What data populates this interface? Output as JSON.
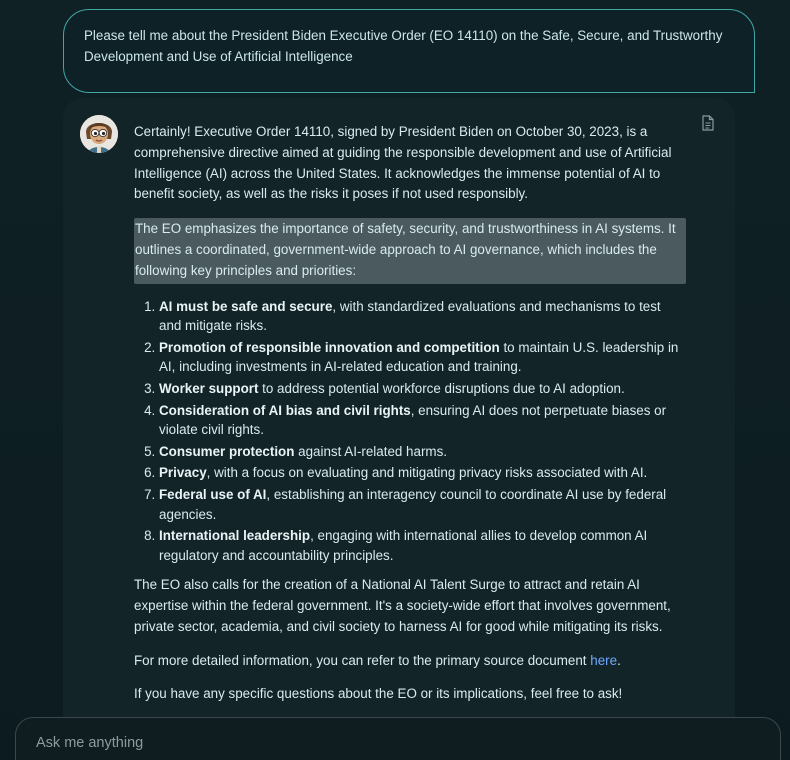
{
  "user_message": "Please tell me about the President Biden Executive Order (EO 14110) on the Safe, Secure, and Trustworthy Development and Use of Artificial Intelligence",
  "assistant": {
    "intro": "Certainly! Executive Order 14110, signed by President Biden on October 30, 2023, is a comprehensive directive aimed at guiding the responsible development and use of Artificial Intelligence (AI) across the United States. It acknowledges the immense potential of AI to benefit society, as well as the risks it poses if not used responsibly.",
    "highlighted": "The EO emphasizes the importance of safety, security, and trustworthiness in AI systems. It outlines a coordinated, government-wide approach to AI governance, which includes the following key principles and priorities:",
    "principles": [
      {
        "bold": "AI must be safe and secure",
        "rest": ", with standardized evaluations and mechanisms to test and mitigate risks."
      },
      {
        "bold": "Promotion of responsible innovation and competition",
        "rest": " to maintain U.S. leadership in AI, including investments in AI-related education and training."
      },
      {
        "bold": "Worker support",
        "rest": " to address potential workforce disruptions due to AI adoption."
      },
      {
        "bold": "Consideration of AI bias and civil rights",
        "rest": ", ensuring AI does not perpetuate biases or violate civil rights."
      },
      {
        "bold": "Consumer protection",
        "rest": " against AI-related harms."
      },
      {
        "bold": "Privacy",
        "rest": ", with a focus on evaluating and mitigating privacy risks associated with AI."
      },
      {
        "bold": "Federal use of AI",
        "rest": ", establishing an interagency council to coordinate AI use by federal agencies."
      },
      {
        "bold": "International leadership",
        "rest": ", engaging with international allies to develop common AI regulatory and accountability principles."
      }
    ],
    "talent_surge": "The EO also calls for the creation of a National AI Talent Surge to attract and retain AI expertise within the federal government. It's a society-wide effort that involves government, private sector, academia, and civil society to harness AI for good while mitigating its risks.",
    "more_info_prefix": "For more detailed information, you can refer to the primary source document ",
    "more_info_link": "here",
    "more_info_suffix": ".",
    "closing": "If you have any specific questions about the EO or its implications, feel free to ask!"
  },
  "input": {
    "placeholder": "Ask me anything"
  },
  "icons": {
    "copy": "document-copy-icon",
    "avatar": "assistant-avatar"
  },
  "colors": {
    "background": "#0e1e22",
    "user_border": "#3fa7a6",
    "card": "#132428",
    "highlight": "#4a5a5e",
    "link": "#6ea8ff"
  }
}
